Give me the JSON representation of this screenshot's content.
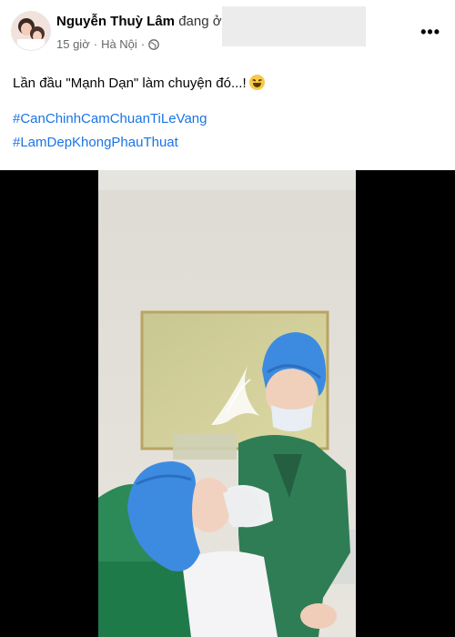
{
  "post": {
    "author_name": "Nguyễn Thuỳ Lâm",
    "author_suffix": "đang ở",
    "time": "15 giờ",
    "separator": "·",
    "location": "Hà Nội",
    "separator2": "·",
    "privacy_icon": "globe-icon",
    "more_icon": "more-options-icon",
    "more_label": "•••",
    "caption": "Lần đầu \"Mạnh Dạn\" làm chuyện đó...!",
    "caption_emoji": "laughing-face-emoji",
    "hashtags": [
      "#CanChinhCamChuanTiLeVang",
      "#LamDepKhongPhauThuat"
    ]
  },
  "colors": {
    "hashtag": "#1b74e4",
    "meta_text": "#65676b",
    "video_letterbox": "#000000",
    "scrub_cap": "#3d8be0",
    "scrub_gown": "#2f7d55"
  }
}
